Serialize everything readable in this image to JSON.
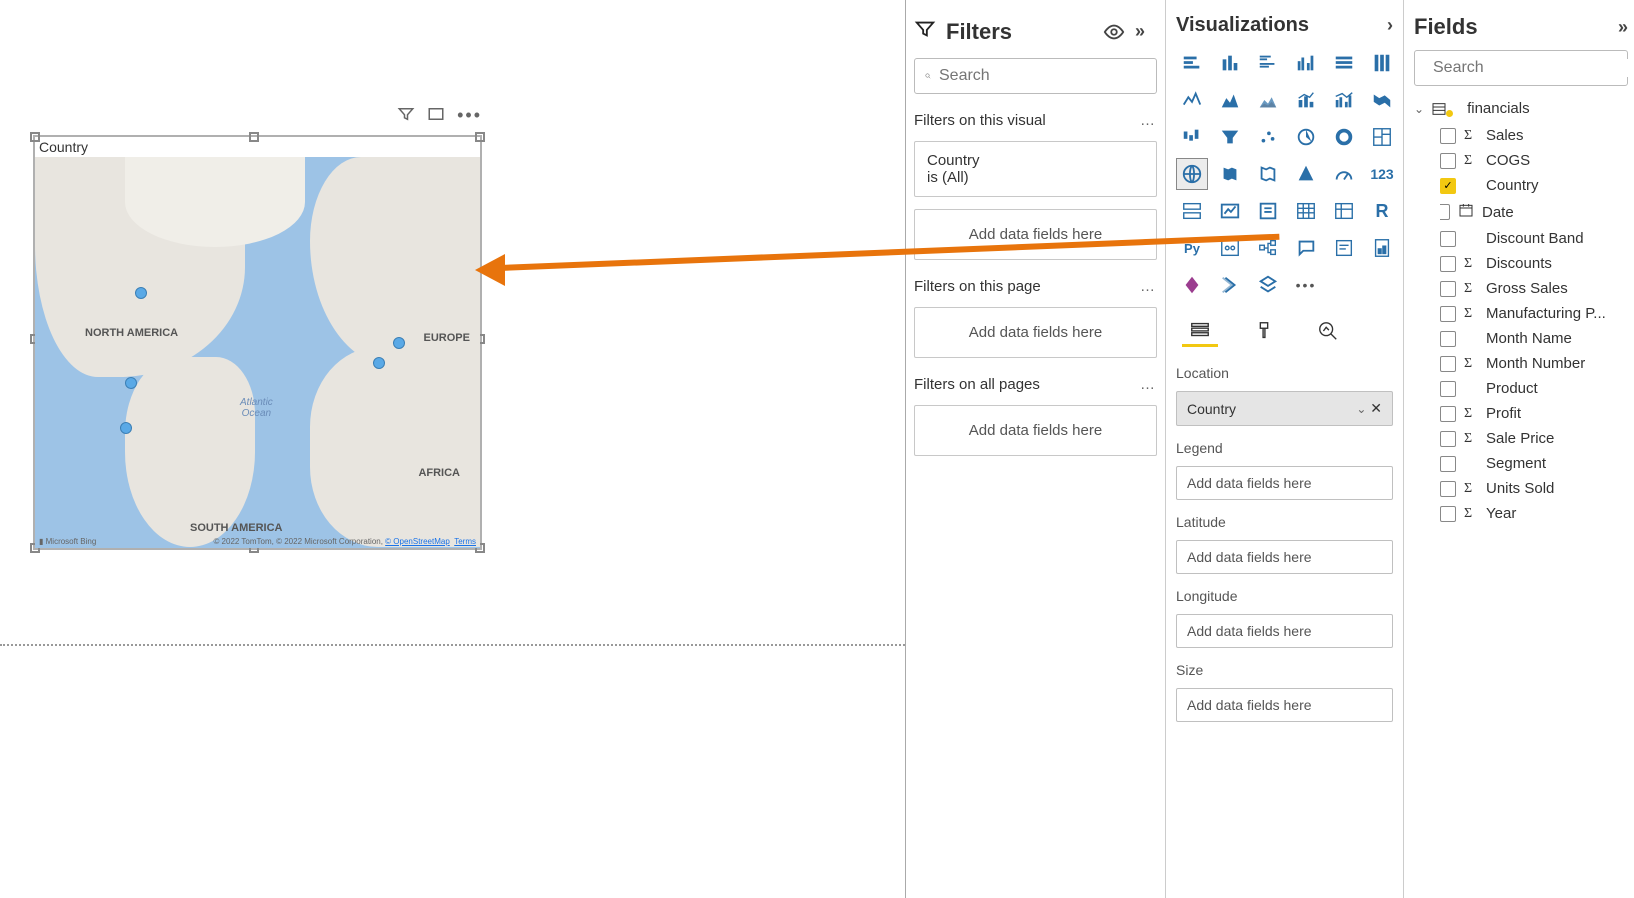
{
  "map": {
    "title": "Country",
    "labels": {
      "na": "NORTH AMERICA",
      "sa": "SOUTH AMERICA",
      "eu": "EUROPE",
      "af": "AFRICA",
      "ocean": "Atlantic\nOcean"
    },
    "bing": "Microsoft Bing",
    "copy": "© 2022 TomTom, © 2022 Microsoft Corporation,",
    "osm": "© OpenStreetMap",
    "terms": "Terms"
  },
  "filters": {
    "title": "Filters",
    "search": "Search",
    "visual_header": "Filters on this visual",
    "card": {
      "field": "Country",
      "summary": "is (All)"
    },
    "drop": "Add data fields here",
    "page_header": "Filters on this page",
    "all_header": "Filters on all pages"
  },
  "viz": {
    "title": "Visualizations",
    "wells": {
      "location": "Location",
      "location_val": "Country",
      "legend": "Legend",
      "latitude": "Latitude",
      "longitude": "Longitude",
      "size": "Size",
      "placeholder": "Add data fields here"
    }
  },
  "fields": {
    "title": "Fields",
    "search": "Search",
    "table": "financials",
    "items": [
      {
        "name": "Sales",
        "sigma": true,
        "checked": false
      },
      {
        "name": "COGS",
        "sigma": true,
        "checked": false
      },
      {
        "name": "Country",
        "sigma": false,
        "checked": true
      },
      {
        "name": "Date",
        "sigma": false,
        "checked": false,
        "date": true
      },
      {
        "name": "Discount Band",
        "sigma": false,
        "checked": false
      },
      {
        "name": "Discounts",
        "sigma": true,
        "checked": false
      },
      {
        "name": "Gross Sales",
        "sigma": true,
        "checked": false
      },
      {
        "name": "Manufacturing P...",
        "sigma": true,
        "checked": false
      },
      {
        "name": "Month Name",
        "sigma": false,
        "checked": false
      },
      {
        "name": "Month Number",
        "sigma": true,
        "checked": false
      },
      {
        "name": "Product",
        "sigma": false,
        "checked": false
      },
      {
        "name": "Profit",
        "sigma": true,
        "checked": false
      },
      {
        "name": "Sale Price",
        "sigma": true,
        "checked": false
      },
      {
        "name": "Segment",
        "sigma": false,
        "checked": false
      },
      {
        "name": "Units Sold",
        "sigma": true,
        "checked": false
      },
      {
        "name": "Year",
        "sigma": true,
        "checked": false
      }
    ]
  }
}
